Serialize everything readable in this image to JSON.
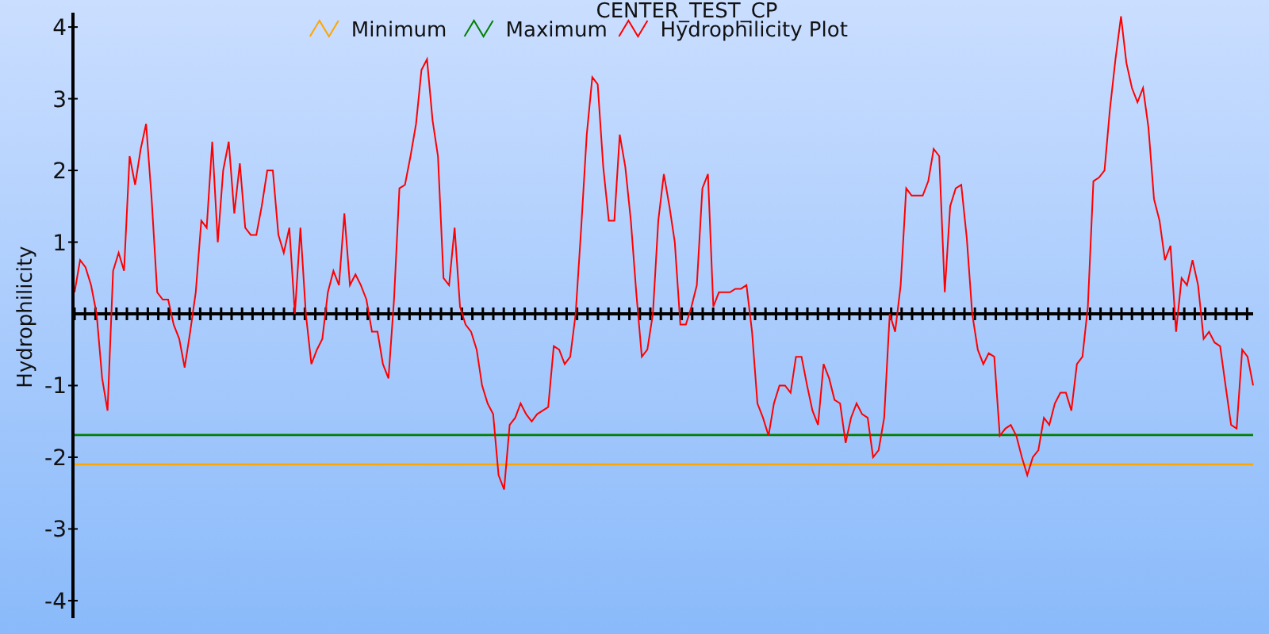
{
  "chart_data": {
    "type": "line",
    "title": "CENTER_TEST_CP",
    "ylabel": "Hydrophilicity",
    "ylim": [
      -4.2,
      4.2
    ],
    "legend": "top",
    "yticks": [
      4,
      3,
      2,
      1,
      -1,
      -2,
      -3,
      -4
    ],
    "ref_lines": [
      {
        "axis": "y",
        "value": -2.1,
        "label": "Minimum",
        "color": "#ffa500"
      },
      {
        "axis": "y",
        "value": -1.69,
        "label": "Maximum",
        "color": "#008000"
      }
    ],
    "series": [
      {
        "name": "Hydrophilicity Plot",
        "color": "#ff0000",
        "values": [
          0.3,
          0.75,
          0.65,
          0.4,
          0,
          -0.9,
          -1.35,
          0.6,
          0.85,
          0.6,
          2.2,
          1.8,
          2.3,
          2.65,
          1.6,
          0.3,
          0.2,
          0.2,
          -0.15,
          -0.35,
          -0.75,
          -0.25,
          0.3,
          1.3,
          1.2,
          2.4,
          1.0,
          2.0,
          2.4,
          1.4,
          2.1,
          1.2,
          1.1,
          1.1,
          1.5,
          2.0,
          2.0,
          1.1,
          0.85,
          1.2,
          0,
          1.2,
          0,
          -0.7,
          -0.5,
          -0.35,
          0.3,
          0.6,
          0.4,
          1.4,
          0.4,
          0.55,
          0.4,
          0.2,
          -0.25,
          -0.25,
          -0.7,
          -0.9,
          0.2,
          1.75,
          1.8,
          2.2,
          2.65,
          3.4,
          3.55,
          2.7,
          2.2,
          0.5,
          0.4,
          1.2,
          0.1,
          -0.15,
          -0.25,
          -0.5,
          -1.0,
          -1.25,
          -1.4,
          -2.25,
          -2.45,
          -1.55,
          -1.45,
          -1.25,
          -1.4,
          -1.5,
          -1.4,
          -1.35,
          -1.3,
          -0.45,
          -0.5,
          -0.7,
          -0.6,
          0,
          1.2,
          2.5,
          3.3,
          3.2,
          2.05,
          1.3,
          1.3,
          2.5,
          2.05,
          1.3,
          0.3,
          -0.6,
          -0.5,
          0,
          1.3,
          1.95,
          1.5,
          1.0,
          -0.15,
          -0.15,
          0.1,
          0.4,
          1.75,
          1.95,
          0.1,
          0.3,
          0.3,
          0.3,
          0.35,
          0.35,
          0.4,
          -0.25,
          -1.25,
          -1.45,
          -1.7,
          -1.25,
          -1.0,
          -1.0,
          -1.1,
          -0.6,
          -0.6,
          -1.0,
          -1.35,
          -1.55,
          -0.7,
          -0.9,
          -1.2,
          -1.25,
          -1.8,
          -1.45,
          -1.25,
          -1.4,
          -1.45,
          -2.0,
          -1.9,
          -1.45,
          0,
          -0.25,
          0.4,
          1.75,
          1.65,
          1.65,
          1.65,
          1.85,
          2.3,
          2.2,
          0.3,
          1.5,
          1.75,
          1.8,
          1.05,
          0,
          -0.5,
          -0.7,
          -0.55,
          -0.6,
          -1.7,
          -1.6,
          -1.55,
          -1.7,
          -2.0,
          -2.25,
          -2.0,
          -1.9,
          -1.45,
          -1.55,
          -1.25,
          -1.1,
          -1.1,
          -1.35,
          -0.7,
          -0.6,
          0.1,
          1.85,
          1.9,
          2.0,
          2.85,
          3.55,
          4.15,
          3.5,
          3.15,
          2.95,
          3.15,
          2.6,
          1.6,
          1.3,
          0.75,
          0.95,
          -0.25,
          0.5,
          0.4,
          0.75,
          0.4,
          -0.35,
          -0.25,
          -0.4,
          -0.45,
          -1.0,
          -1.55,
          -1.6,
          -0.5,
          -0.6,
          -1.0
        ]
      }
    ]
  }
}
